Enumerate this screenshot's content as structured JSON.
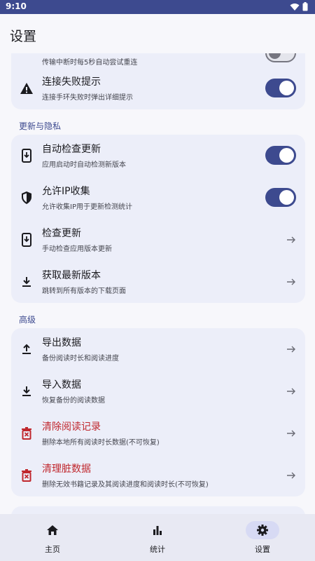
{
  "status": {
    "time": "9:10"
  },
  "appbar": {
    "title": "设置"
  },
  "sections": {
    "connection": {
      "partial_sub": "传输中断时每5秒自动尝试重连",
      "fail_title": "连接失败提示",
      "fail_sub": "连接手环失败时弹出详细提示"
    },
    "update": {
      "label": "更新与隐私",
      "items": [
        {
          "title": "自动检查更新",
          "sub": "应用启动时自动检测新版本"
        },
        {
          "title": "允许IP收集",
          "sub": "允许收集IP用于更新检测统计"
        },
        {
          "title": "检查更新",
          "sub": "手动检查应用版本更新"
        },
        {
          "title": "获取最新版本",
          "sub": "跳转到所有版本的下载页面"
        }
      ]
    },
    "advanced": {
      "label": "高级",
      "items": [
        {
          "title": "导出数据",
          "sub": "备份阅读时长和阅读进度"
        },
        {
          "title": "导入数据",
          "sub": "恢复备份的阅读数据"
        },
        {
          "title": "清除阅读记录",
          "sub": "删除本地所有阅读时长数据(不可恢复)"
        },
        {
          "title": "清理脏数据",
          "sub": "删除无效书籍记录及其阅读进度和阅读时长(不可恢复)"
        }
      ]
    }
  },
  "nav": [
    {
      "label": "主页",
      "icon": "home-icon"
    },
    {
      "label": "统计",
      "icon": "bar-chart-icon"
    },
    {
      "label": "设置",
      "icon": "gear-icon"
    }
  ],
  "colors": {
    "accent": "#3d4a8f",
    "danger": "#c0272d",
    "card": "#eceef9"
  }
}
